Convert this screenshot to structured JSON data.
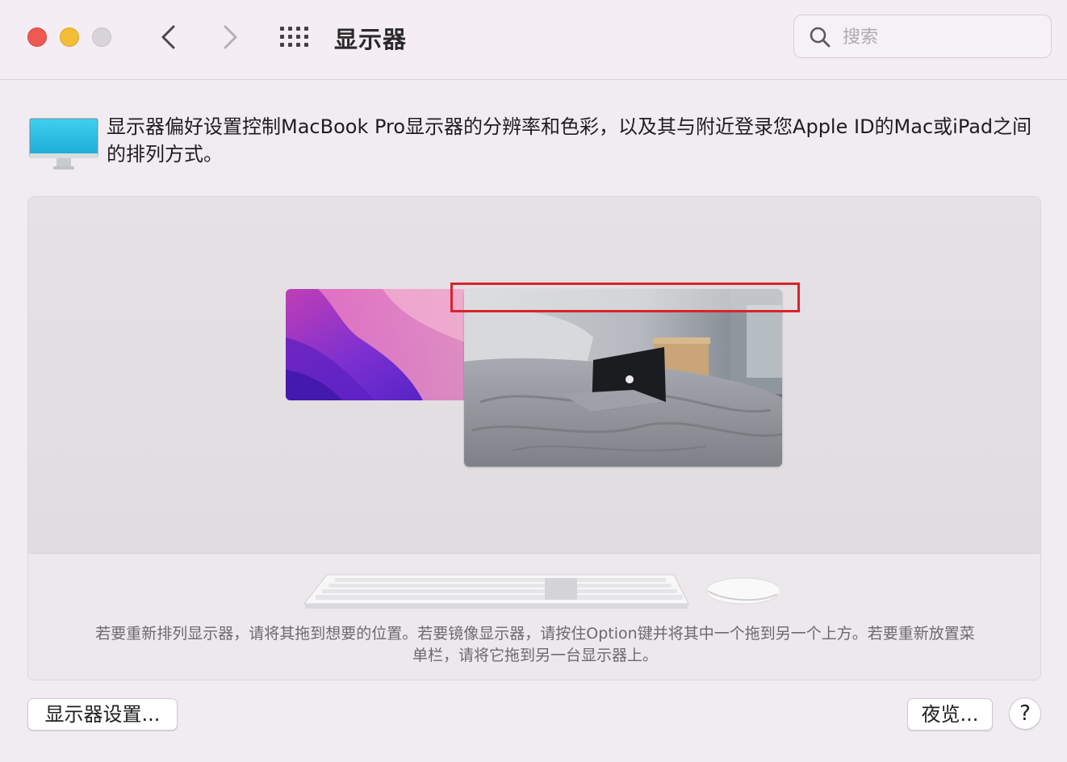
{
  "window": {
    "title": "显示器",
    "traffic_lights": [
      "close",
      "minimize",
      "zoom"
    ]
  },
  "toolbar": {
    "back_icon": "chevron-left-icon",
    "forward_icon": "chevron-right-icon",
    "show_all_icon": "grid-icon",
    "search": {
      "placeholder": "搜索",
      "value": "",
      "icon": "search-icon"
    }
  },
  "description": {
    "icon": "display-monitor-icon",
    "text": "显示器偏好设置控制MacBook Pro显示器的分辨率和色彩，以及其与附近登录您Apple ID的Mac或iPad之间的排列方式。"
  },
  "arrangement": {
    "displays": [
      {
        "id": "display-1",
        "wallpaper": "purple-gradient"
      },
      {
        "id": "display-2",
        "wallpaper": "bedroom-photo",
        "has_menu_bar": true
      }
    ],
    "peripherals": [
      "keyboard-icon",
      "mouse-icon"
    ],
    "hint": "若要重新排列显示器，请将其拖到想要的位置。若要镜像显示器，请按住Option键并将其中一个拖到另一个上方。若要重新放置菜单栏，请将它拖到另一台显示器上。"
  },
  "buttons": {
    "display_settings": "显示器设置...",
    "night_shift": "夜览...",
    "help": "?"
  },
  "colors": {
    "close": "#ee5a52",
    "minimize": "#f4bd36",
    "zoom_disabled": "#d9d4d9",
    "highlight": "#d6252b"
  }
}
